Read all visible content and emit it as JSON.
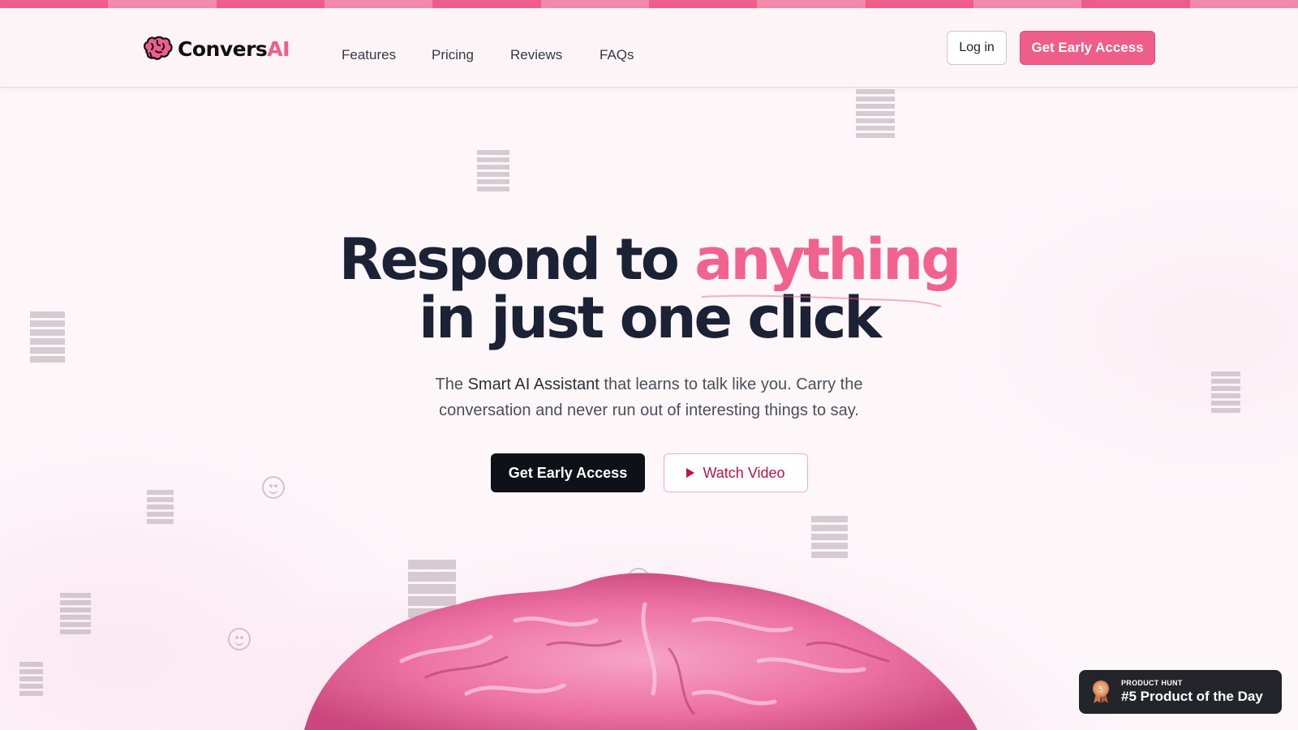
{
  "brand": {
    "name_main": "Convers",
    "name_accent": "AI"
  },
  "nav": {
    "links": [
      "Features",
      "Pricing",
      "Reviews",
      "FAQs"
    ],
    "login_label": "Log in",
    "cta_label": "Get Early Access"
  },
  "hero": {
    "headline_part1": "Respond to ",
    "headline_highlight": "anything",
    "headline_line2": "in just one click",
    "subtitle_pre": "The ",
    "subtitle_strong": "Smart AI Assistant",
    "subtitle_post": " that learns to talk like you. Carry the conversation and never run out of interesting things to say.",
    "primary_cta": "Get Early Access",
    "secondary_cta": "Watch Video"
  },
  "badge": {
    "rank": "5",
    "small": "PRODUCT HUNT",
    "big": "#5 Product of the Day"
  },
  "colors": {
    "accent": "#ef5d8a",
    "dark": "#0f1118",
    "watch_text": "#c0134a"
  },
  "icons": [
    "brain-logo-icon",
    "play-icon",
    "medal-icon",
    "emoji-icon"
  ]
}
